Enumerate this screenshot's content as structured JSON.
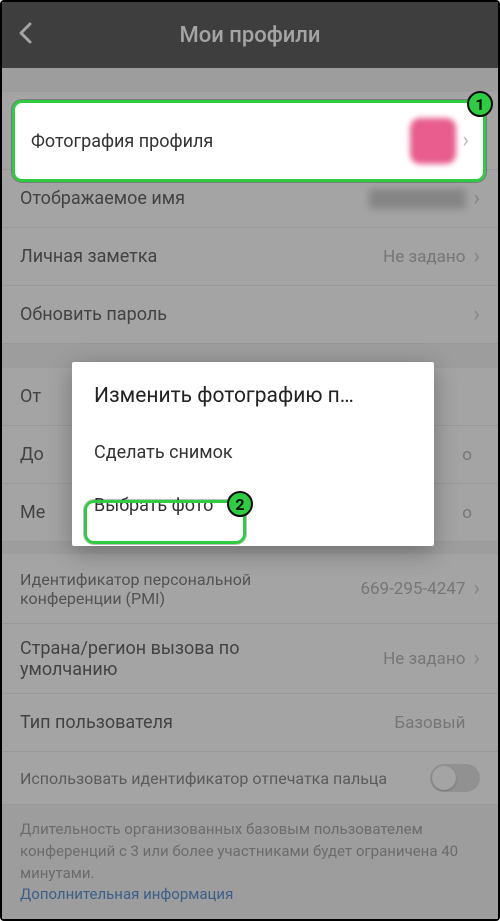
{
  "header": {
    "title": "Мои профили"
  },
  "rows": {
    "profile_photo": {
      "label": "Фотография профиля"
    },
    "display_name": {
      "label": "Отображаемое имя",
      "value": "████████"
    },
    "personal_note": {
      "label": "Личная заметка",
      "value": "Не задано"
    },
    "update_password": {
      "label": "Обновить пароль"
    },
    "department": {
      "label": "От",
      "value": ""
    },
    "position": {
      "label": "До",
      "value": "о"
    },
    "location": {
      "label": "Ме",
      "value": "о"
    },
    "pmi": {
      "label": "Идентификатор персональной конференции (PMI)",
      "value": "669-295-4247"
    },
    "default_region": {
      "label": "Страна/регион вызова по умолчанию",
      "value": "Не задано"
    },
    "user_type": {
      "label": "Тип пользователя",
      "value": "Базовый"
    }
  },
  "switch": {
    "fingerprint": {
      "label": "Использовать идентификатор отпечатка пальца"
    }
  },
  "info": {
    "text": "Длительность организованных базовым пользователем конференций с 3 или более участниками будет ограничена 40 минутами.",
    "link": "Дополнительная информация"
  },
  "dialog": {
    "title": "Изменить фотографию п…",
    "take_photo": "Сделать снимок",
    "choose_photo": "Выбрать фото"
  },
  "annotations": {
    "one": "1",
    "two": "2"
  }
}
